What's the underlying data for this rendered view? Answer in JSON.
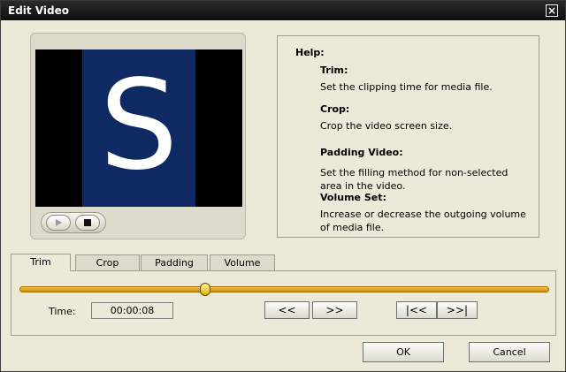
{
  "window": {
    "title": "Edit Video"
  },
  "preview": {
    "letter": "S"
  },
  "help": {
    "title": "Help:",
    "sections": [
      {
        "heading": "Trim:",
        "body": "Set the clipping time for media file."
      },
      {
        "heading": "Crop:",
        "body": "Crop the video screen size."
      },
      {
        "heading": "Padding Video:",
        "body": "Set the filling method for non-selected area in the video."
      },
      {
        "heading": "Volume Set:",
        "body": "Increase or decrease the outgoing volume of media file."
      }
    ]
  },
  "tabs": [
    {
      "label": "Trim",
      "active": true
    },
    {
      "label": "Crop",
      "active": false
    },
    {
      "label": "Padding",
      "active": false
    },
    {
      "label": "Volume",
      "active": false
    }
  ],
  "trim": {
    "time_label": "Time:",
    "time_value": "00:00:08",
    "position_fraction": 0.35,
    "buttons": [
      "<<",
      ">>",
      "|<<",
      ">>|"
    ]
  },
  "dialog_buttons": {
    "ok": "OK",
    "cancel": "Cancel"
  },
  "colors": {
    "titlebar": "#111111",
    "slider": "#e7a70f",
    "video_bg": "#0f2a63"
  }
}
